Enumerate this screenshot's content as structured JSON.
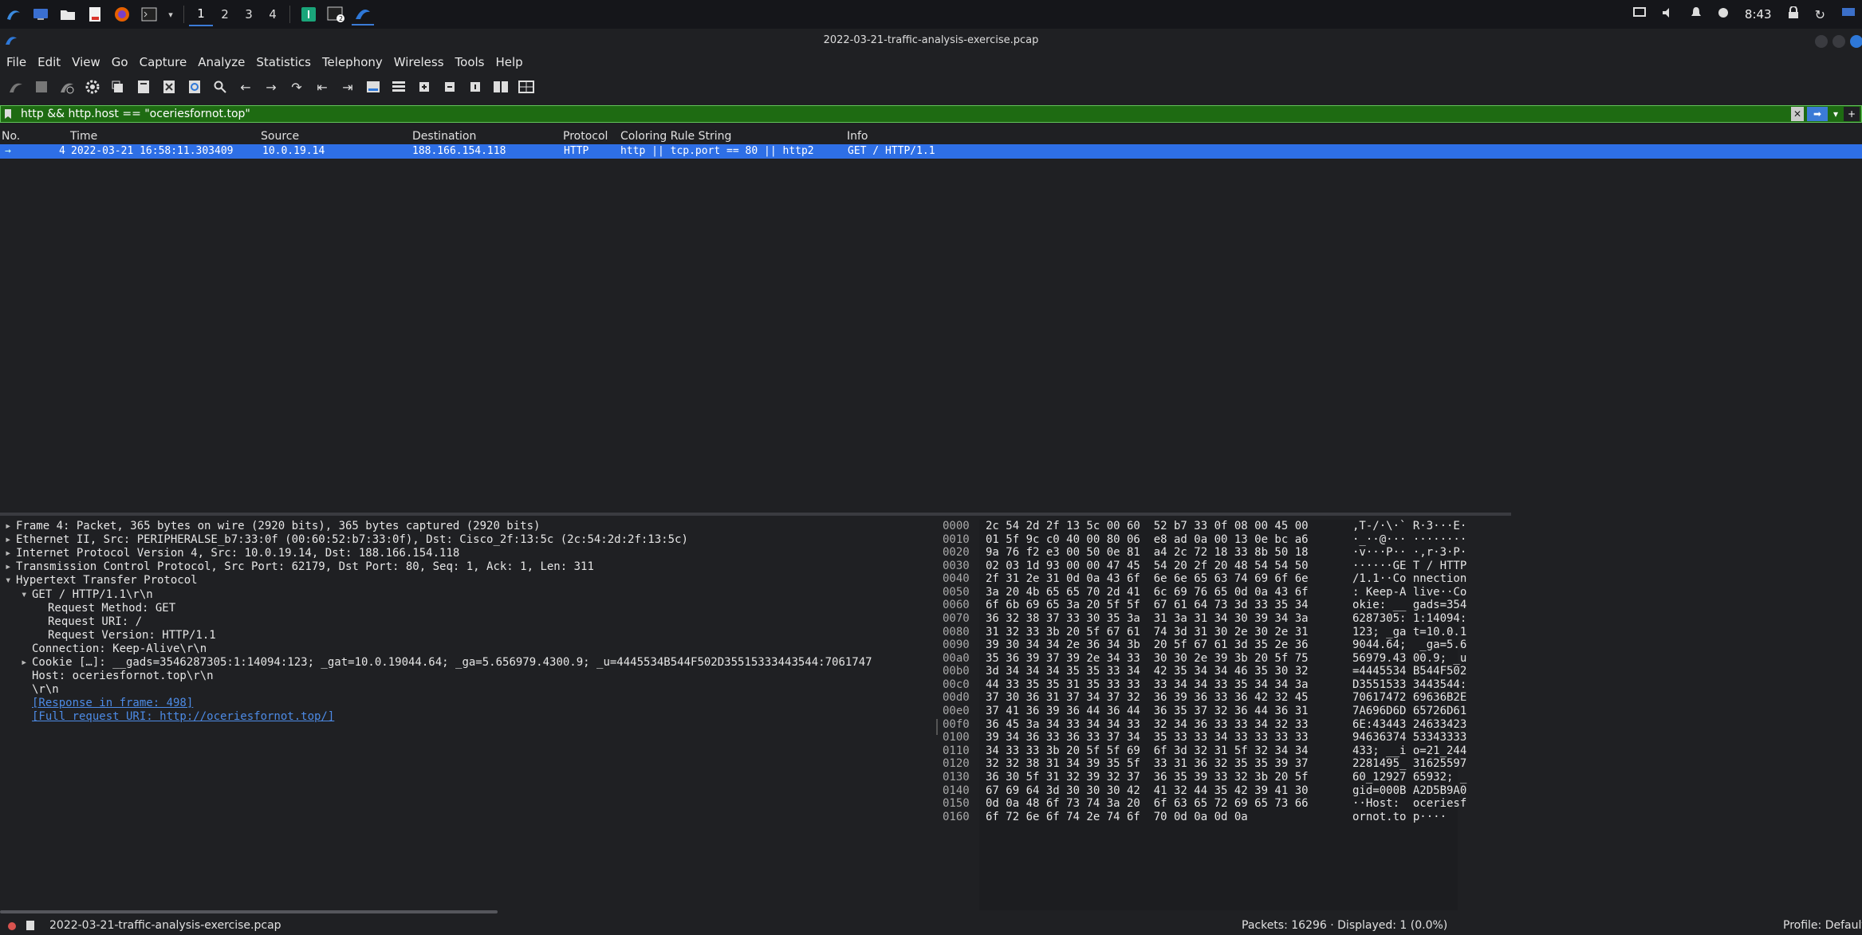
{
  "taskbar": {
    "workspaces": [
      "1",
      "2",
      "3",
      "4"
    ],
    "clock": "8:43"
  },
  "window": {
    "title": "2022-03-21-traffic-analysis-exercise.pcap"
  },
  "menu": [
    "File",
    "Edit",
    "View",
    "Go",
    "Capture",
    "Analyze",
    "Statistics",
    "Telephony",
    "Wireless",
    "Tools",
    "Help"
  ],
  "filter": {
    "value": "http && http.host == \"oceriesfornot.top\""
  },
  "packet_list": {
    "columns": [
      "No.",
      "Time",
      "Source",
      "Destination",
      "Protocol",
      "Coloring Rule String",
      "Info"
    ],
    "rows": [
      {
        "no": "4",
        "time": "2022-03-21 16:58:11.303409",
        "source": "10.0.19.14",
        "destination": "188.166.154.118",
        "protocol": "HTTP",
        "coloring_rule": "http || tcp.port == 80 || http2",
        "info": "GET / HTTP/1.1"
      }
    ]
  },
  "details": [
    {
      "arrow": "▸",
      "indent": 0,
      "text": "Frame 4: Packet, 365 bytes on wire (2920 bits), 365 bytes captured (2920 bits)"
    },
    {
      "arrow": "▸",
      "indent": 0,
      "text": "Ethernet II, Src: PERIPHERALSE_b7:33:0f (00:60:52:b7:33:0f), Dst: Cisco_2f:13:5c (2c:54:2d:2f:13:5c)"
    },
    {
      "arrow": "▸",
      "indent": 0,
      "text": "Internet Protocol Version 4, Src: 10.0.19.14, Dst: 188.166.154.118"
    },
    {
      "arrow": "▸",
      "indent": 0,
      "text": "Transmission Control Protocol, Src Port: 62179, Dst Port: 80, Seq: 1, Ack: 1, Len: 311"
    },
    {
      "arrow": "▾",
      "indent": 0,
      "text": "Hypertext Transfer Protocol"
    },
    {
      "arrow": "▾",
      "indent": 1,
      "text": "GET / HTTP/1.1\\r\\n"
    },
    {
      "arrow": "",
      "indent": 2,
      "text": "Request Method: GET"
    },
    {
      "arrow": "",
      "indent": 2,
      "text": "Request URI: /"
    },
    {
      "arrow": "",
      "indent": 2,
      "text": "Request Version: HTTP/1.1"
    },
    {
      "arrow": "",
      "indent": 1,
      "text": "Connection: Keep-Alive\\r\\n"
    },
    {
      "arrow": "▸",
      "indent": 1,
      "text": "Cookie […]: __gads=3546287305:1:14094:123; _gat=10.0.19044.64; _ga=5.656979.4300.9; _u=4445534B544F502D35515333443544:7061747"
    },
    {
      "arrow": "",
      "indent": 1,
      "text": "Host: oceriesfornot.top\\r\\n"
    },
    {
      "arrow": "",
      "indent": 1,
      "text": "\\r\\n"
    },
    {
      "arrow": "",
      "indent": 1,
      "text": "[Response in frame: 498]",
      "link": true
    },
    {
      "arrow": "",
      "indent": 1,
      "text": "[Full request URI: http://oceriesfornot.top/]",
      "link": true
    }
  ],
  "bytes": [
    {
      "off": "0000",
      "hex": "2c 54 2d 2f 13 5c 00 60  52 b7 33 0f 08 00 45 00",
      "ascii": ",T-/·\\·` R·3···E·"
    },
    {
      "off": "0010",
      "hex": "01 5f 9c c0 40 00 80 06  e8 ad 0a 00 13 0e bc a6",
      "ascii": "·_··@··· ········"
    },
    {
      "off": "0020",
      "hex": "9a 76 f2 e3 00 50 0e 81  a4 2c 72 18 33 8b 50 18",
      "ascii": "·v···P·· ·,r·3·P·"
    },
    {
      "off": "0030",
      "hex": "02 03 1d 93 00 00 47 45  54 20 2f 20 48 54 54 50",
      "ascii": "······GE T / HTTP"
    },
    {
      "off": "0040",
      "hex": "2f 31 2e 31 0d 0a 43 6f  6e 6e 65 63 74 69 6f 6e",
      "ascii": "/1.1··Co nnection"
    },
    {
      "off": "0050",
      "hex": "3a 20 4b 65 65 70 2d 41  6c 69 76 65 0d 0a 43 6f",
      "ascii": ": Keep-A live··Co"
    },
    {
      "off": "0060",
      "hex": "6f 6b 69 65 3a 20 5f 5f  67 61 64 73 3d 33 35 34",
      "ascii": "okie: __ gads=354"
    },
    {
      "off": "0070",
      "hex": "36 32 38 37 33 30 35 3a  31 3a 31 34 30 39 34 3a",
      "ascii": "6287305: 1:14094:"
    },
    {
      "off": "0080",
      "hex": "31 32 33 3b 20 5f 67 61  74 3d 31 30 2e 30 2e 31",
      "ascii": "123; _ga t=10.0.1"
    },
    {
      "off": "0090",
      "hex": "39 30 34 34 2e 36 34 3b  20 5f 67 61 3d 35 2e 36",
      "ascii": "9044.64;  _ga=5.6"
    },
    {
      "off": "00a0",
      "hex": "35 36 39 37 39 2e 34 33  30 30 2e 39 3b 20 5f 75",
      "ascii": "56979.43 00.9; _u"
    },
    {
      "off": "00b0",
      "hex": "3d 34 34 34 35 35 33 34  42 35 34 34 46 35 30 32",
      "ascii": "=4445534 B544F502"
    },
    {
      "off": "00c0",
      "hex": "44 33 35 35 31 35 33 33  33 34 34 33 35 34 34 3a",
      "ascii": "D3551533 3443544:"
    },
    {
      "off": "00d0",
      "hex": "37 30 36 31 37 34 37 32  36 39 36 33 36 42 32 45",
      "ascii": "70617472 69636B2E"
    },
    {
      "off": "00e0",
      "hex": "37 41 36 39 36 44 36 44  36 35 37 32 36 44 36 31",
      "ascii": "7A696D6D 65726D61"
    },
    {
      "off": "00f0",
      "hex": "36 45 3a 34 33 34 34 33  32 34 36 33 33 34 32 33",
      "ascii": "6E:43443 24633423"
    },
    {
      "off": "0100",
      "hex": "39 34 36 33 36 33 37 34  35 33 33 34 33 33 33 33",
      "ascii": "94636374 53343333"
    },
    {
      "off": "0110",
      "hex": "34 33 33 3b 20 5f 5f 69  6f 3d 32 31 5f 32 34 34",
      "ascii": "433; __i o=21_244"
    },
    {
      "off": "0120",
      "hex": "32 32 38 31 34 39 35 5f  33 31 36 32 35 35 39 37",
      "ascii": "2281495_ 31625597"
    },
    {
      "off": "0130",
      "hex": "36 30 5f 31 32 39 32 37  36 35 39 33 32 3b 20 5f",
      "ascii": "60_12927 65932; _"
    },
    {
      "off": "0140",
      "hex": "67 69 64 3d 30 30 30 42  41 32 44 35 42 39 41 30",
      "ascii": "gid=000B A2D5B9A0"
    },
    {
      "off": "0150",
      "hex": "0d 0a 48 6f 73 74 3a 20  6f 63 65 72 69 65 73 66",
      "ascii": "··Host:  oceriesf"
    },
    {
      "off": "0160",
      "hex": "6f 72 6e 6f 74 2e 74 6f  70 0d 0a 0d 0a",
      "ascii": "ornot.to p····"
    }
  ],
  "status": {
    "file": "2022-03-21-traffic-analysis-exercise.pcap",
    "packets": "Packets: 16296 · Displayed: 1 (0.0%)",
    "profile": "Profile: Default"
  }
}
